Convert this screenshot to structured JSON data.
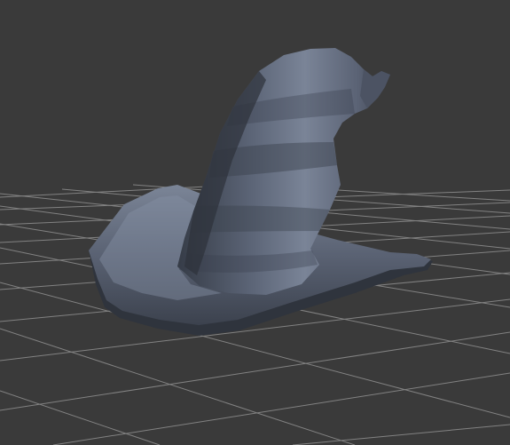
{
  "viewport": {
    "background_color": "#3a3a3a",
    "grid_line_color": "#8a8a8a",
    "grid_visible": true
  },
  "model": {
    "object": "wizard-hat",
    "base_color": "#4a5160",
    "highlight_color": "#7d879a",
    "shadow_color": "#2a2f38"
  }
}
